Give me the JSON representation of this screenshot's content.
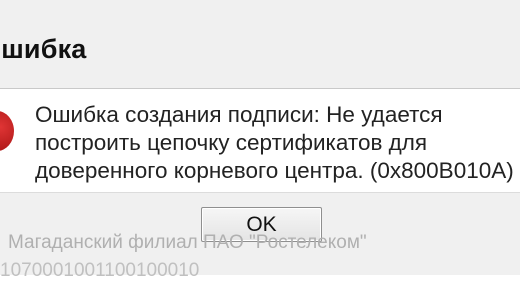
{
  "dialog": {
    "title": "Ошибка",
    "message": "Ошибка создания подписи: Не удается\nпостроить цепочку сертификатов для\nдоверенного корневого центра. (0x800B010A)",
    "ok_label": "OK",
    "icon": "error-icon",
    "accent_color": "#c62828"
  },
  "background": {
    "line1": "Магаданский филиал ПАО \"Ростелеком\"",
    "line2": "1070001001100100010"
  }
}
